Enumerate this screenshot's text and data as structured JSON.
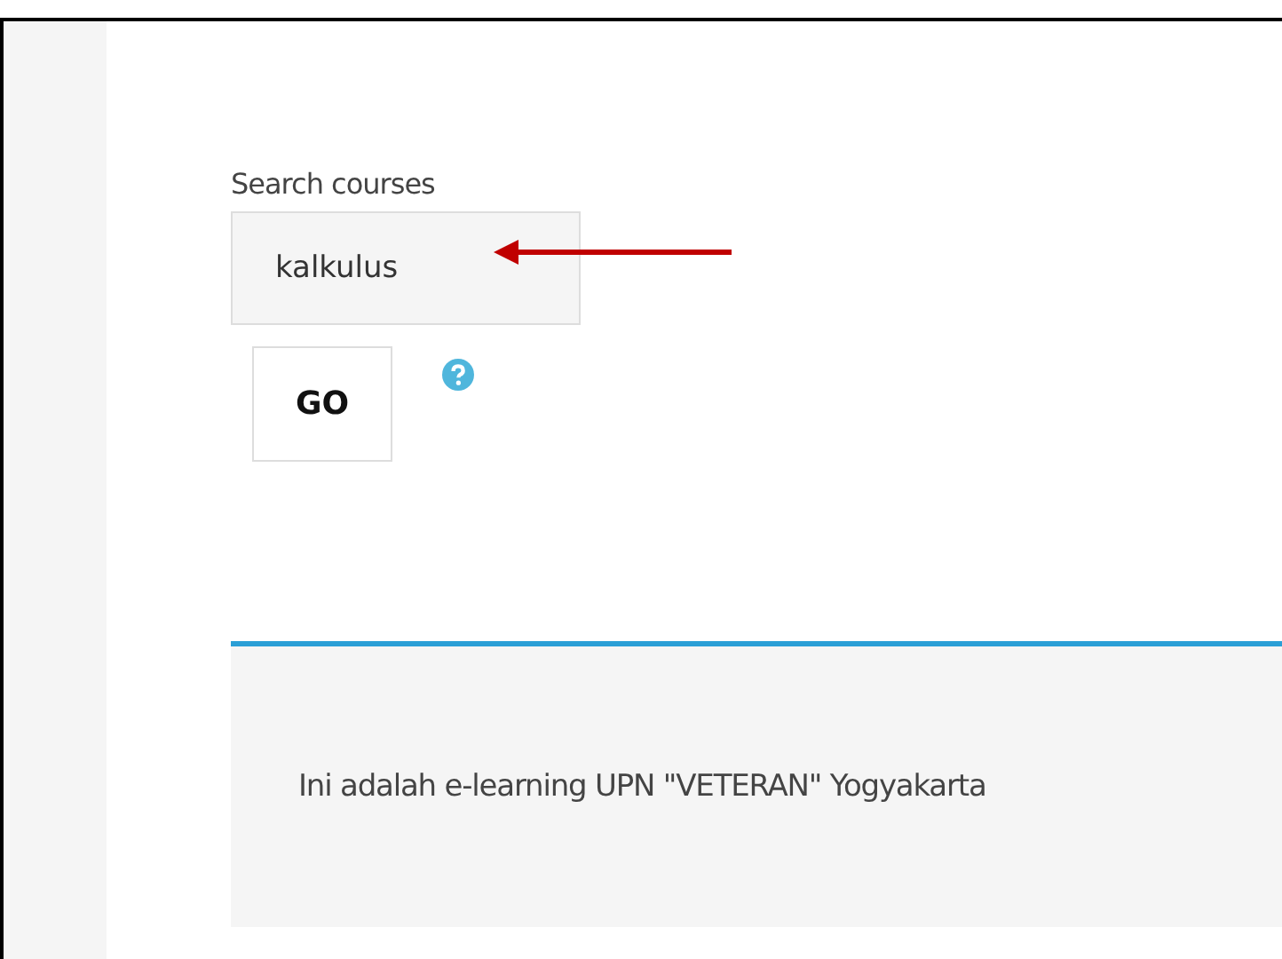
{
  "search": {
    "label": "Search courses",
    "value": "kalkulus",
    "button": "GO"
  },
  "notice": {
    "text": "Ini adalah e-learning UPN \"VETERAN\" Yogyakarta"
  }
}
